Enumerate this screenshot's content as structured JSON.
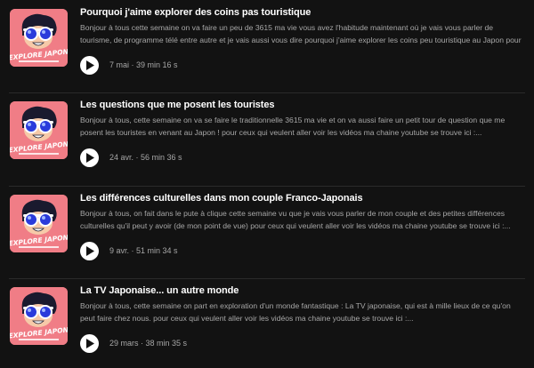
{
  "episodes": [
    {
      "cover_icon": "explore-japon-cover",
      "cover_text": "EXPLORE JAPON",
      "title": "Pourquoi j'aime explorer des coins pas touristique",
      "description": "Bonjour à tous cette semaine on va faire un peu de 3615 ma vie vous avez l'habitude maintenant où je vais vous parler de tourisme, de programme télé entre autre et je vais aussi vous dire pourquoi j'aime explorer les coins peu touristique au Japon pour ceux qui...",
      "date": "7 mai",
      "duration": "39 min 16 s"
    },
    {
      "cover_icon": "explore-japon-cover",
      "cover_text": "EXPLORE JAPON",
      "title": "Les questions que me posent les touristes",
      "description": "Bonjour à tous, cette semaine on va se faire le traditionnelle 3615 ma vie et on va aussi faire un petit tour de question que me posent les touristes en venant au Japon ! pour ceux qui veulent aller voir les vidéos ma chaine youtube se trouve ici :...",
      "date": "24 avr.",
      "duration": "56 min 36 s"
    },
    {
      "cover_icon": "explore-japon-cover",
      "cover_text": "EXPLORE JAPON",
      "title": "Les différences culturelles dans mon couple Franco-Japonais",
      "description": "Bonjour à tous, on fait dans le pute à clique cette semaine vu que je vais vous parler de mon couple et des petites différences culturelles qu'il peut y avoir (de mon point de vue) pour ceux qui veulent aller voir les vidéos ma chaine youtube se trouve ici :...",
      "date": "9 avr.",
      "duration": "51 min 34 s"
    },
    {
      "cover_icon": "explore-japon-cover",
      "cover_text": "EXPLORE JAPON",
      "title": "La TV Japonaise... un autre monde",
      "description": "Bonjour à tous, cette semaine on part en exploration d'un monde fantastique : La TV japonaise, qui est à mille lieux de ce qu'on peut faire chez nous. pour ceux qui veulent aller voir les vidéos ma chaine youtube se trouve ici :...",
      "date": "29 mars",
      "duration": "38 min 35 s"
    }
  ],
  "separator": " · ",
  "colors": {
    "background": "#121212",
    "title": "#ffffff",
    "secondary_text": "#a7a7a7",
    "play_button": "#ffffff",
    "cover_pink": "#f07d86"
  }
}
